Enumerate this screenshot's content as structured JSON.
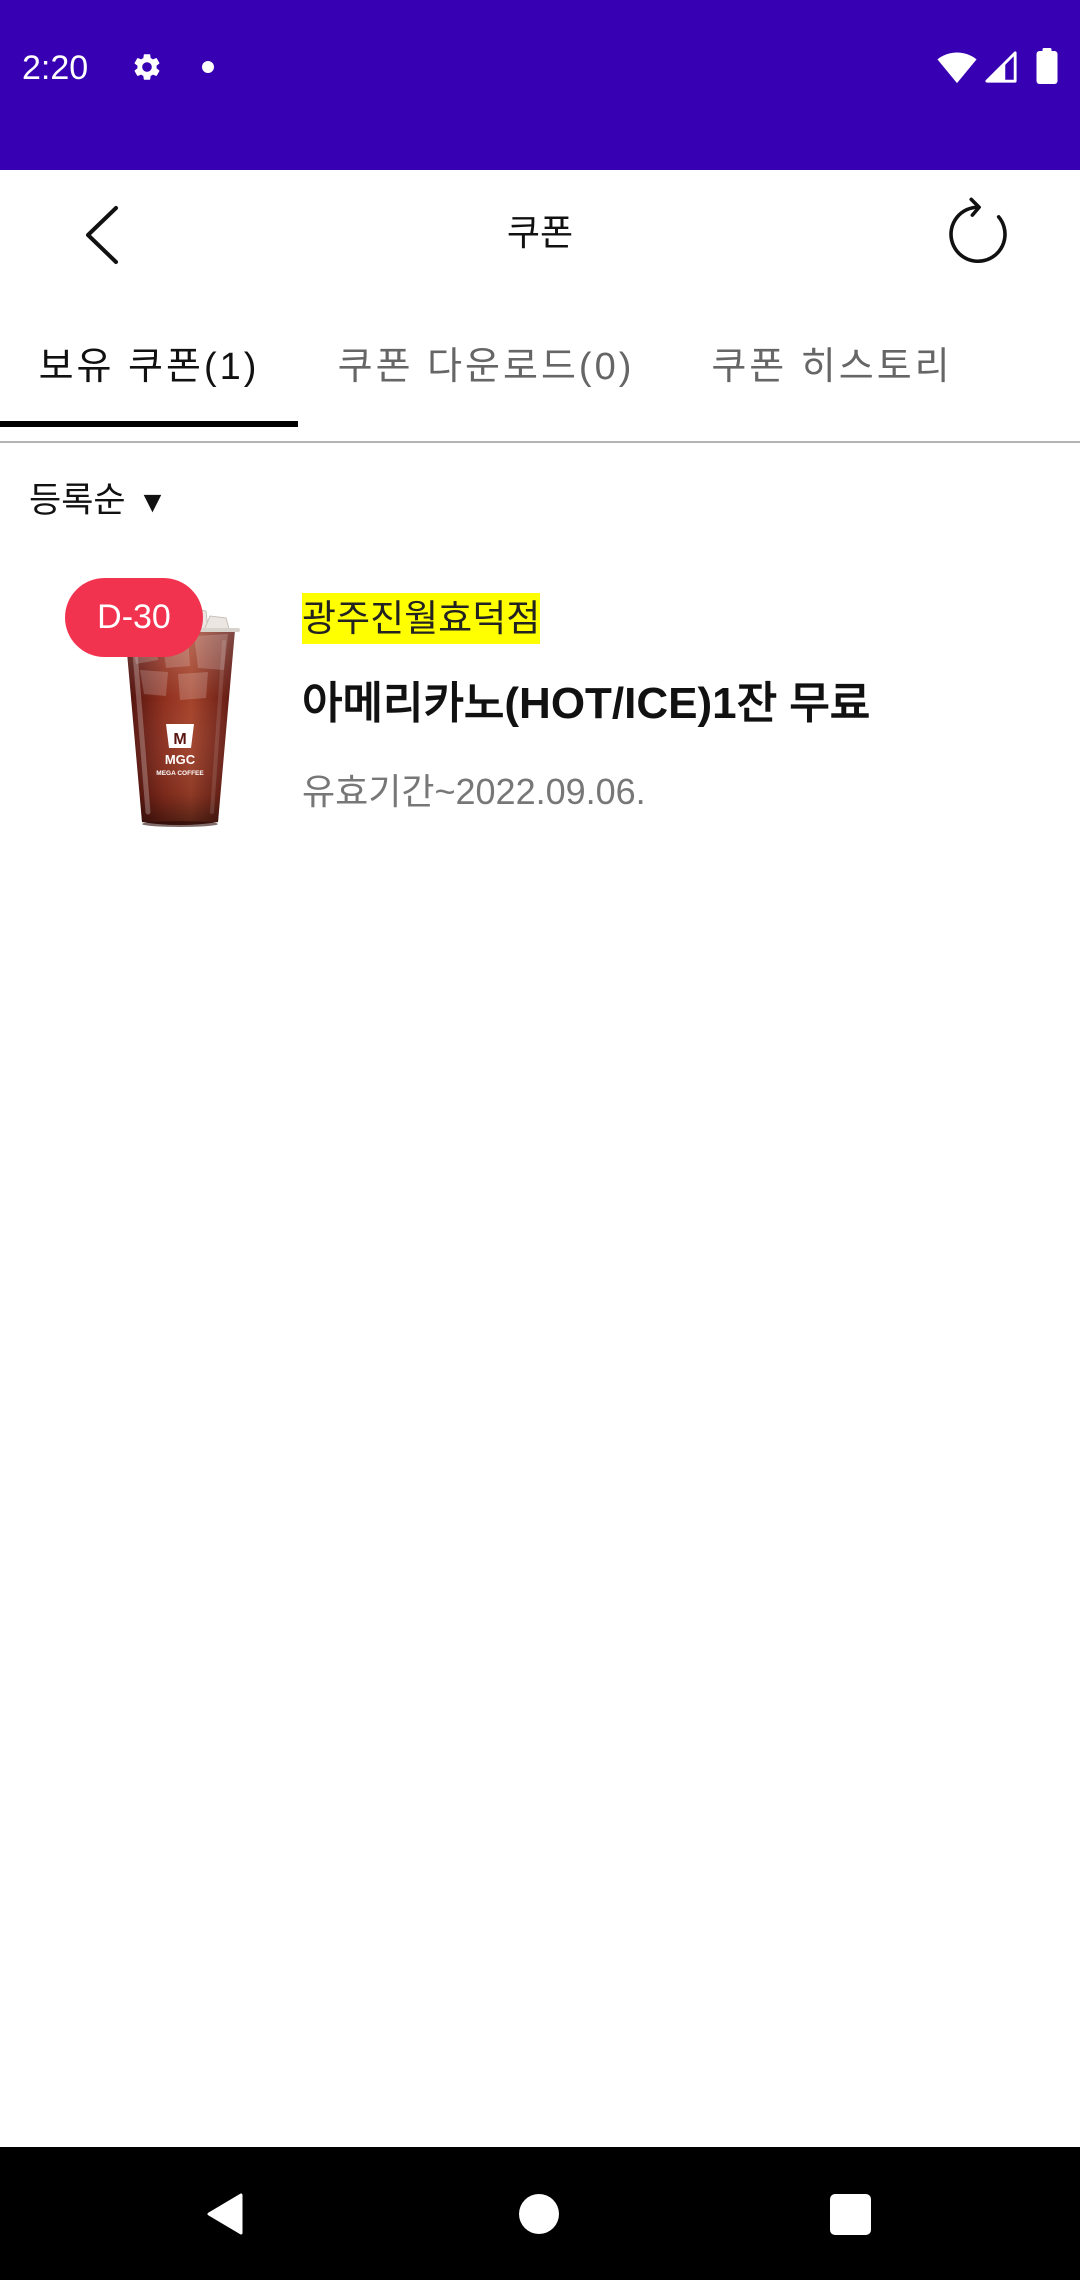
{
  "colors": {
    "status_bar": "#3700B3",
    "badge": "#F2334F",
    "store_highlight": "#FFFF00",
    "tab_indicator": "#000000",
    "validity_text": "#777777"
  },
  "status_bar": {
    "time": "2:20",
    "icons": [
      "settings-icon",
      "notification-dot-icon",
      "wifi-icon",
      "cell-signal-icon",
      "battery-icon"
    ]
  },
  "app_bar": {
    "title": "쿠폰",
    "left_icon": "back-arrow-icon",
    "right_icon": "refresh-icon"
  },
  "tabs": [
    {
      "label": "보유 쿠폰(1)",
      "selected": true
    },
    {
      "label": "쿠폰 다운로드(0)",
      "selected": false
    },
    {
      "label": "쿠폰 히스토리",
      "selected": false
    }
  ],
  "sort": {
    "label": "등록순",
    "indicator": "▼"
  },
  "coupons": [
    {
      "badge": "D-30",
      "store": "광주진월효덕점",
      "title": "아메리카노(HOT/ICE)1잔 무료",
      "validity": "유효기간~2022.09.06.",
      "image": "iced-americano-image",
      "image_logo": {
        "mark": "MGC",
        "brand": "MEGA COFFEE"
      }
    }
  ],
  "nav_bar": {
    "icons": [
      "nav-back-icon",
      "nav-home-icon",
      "nav-recents-icon"
    ]
  }
}
